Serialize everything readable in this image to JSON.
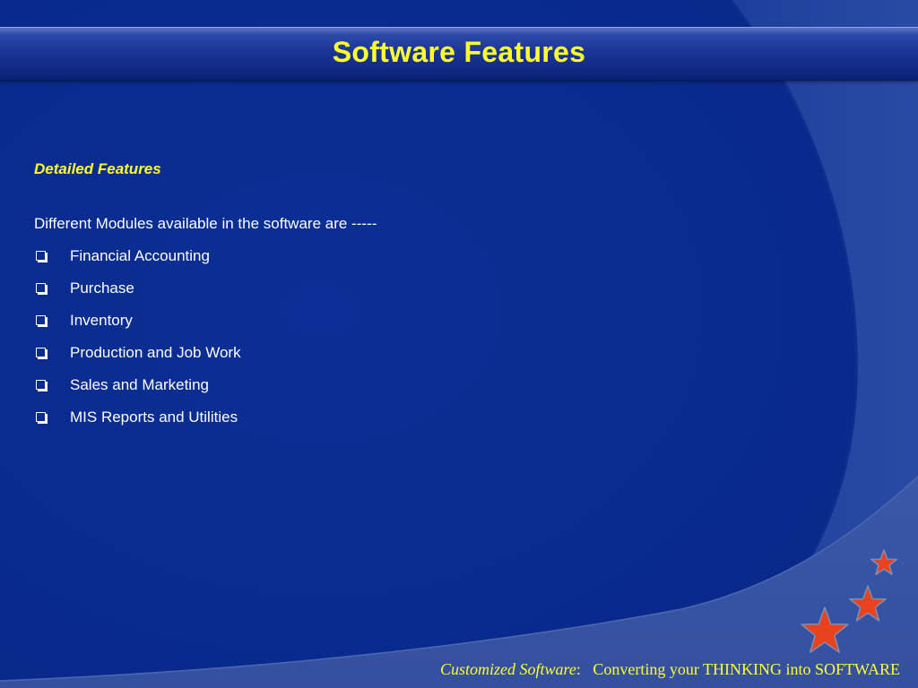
{
  "slide": {
    "title": "Software Features",
    "subheading": "Detailed Features",
    "intro": "Different Modules available in the software are -----",
    "modules": [
      {
        "label": "Financial Accounting"
      },
      {
        "label": "Purchase"
      },
      {
        "label": "Inventory"
      },
      {
        "label": "Production and Job Work"
      },
      {
        "label": "Sales and Marketing"
      },
      {
        "label": "MIS Reports and Utilities"
      }
    ]
  },
  "footer": {
    "brand": "Customized Software",
    "separator": ":",
    "tagline": "Converting your THINKING into SOFTWARE"
  },
  "icons": {
    "bullet": "checkbox-icon",
    "stars": [
      "star-icon",
      "star-icon",
      "star-icon"
    ]
  },
  "colors": {
    "background": "#0a2c8e",
    "title": "#ffff2e",
    "body_text": "#ffffff",
    "star": "#e8421f"
  }
}
